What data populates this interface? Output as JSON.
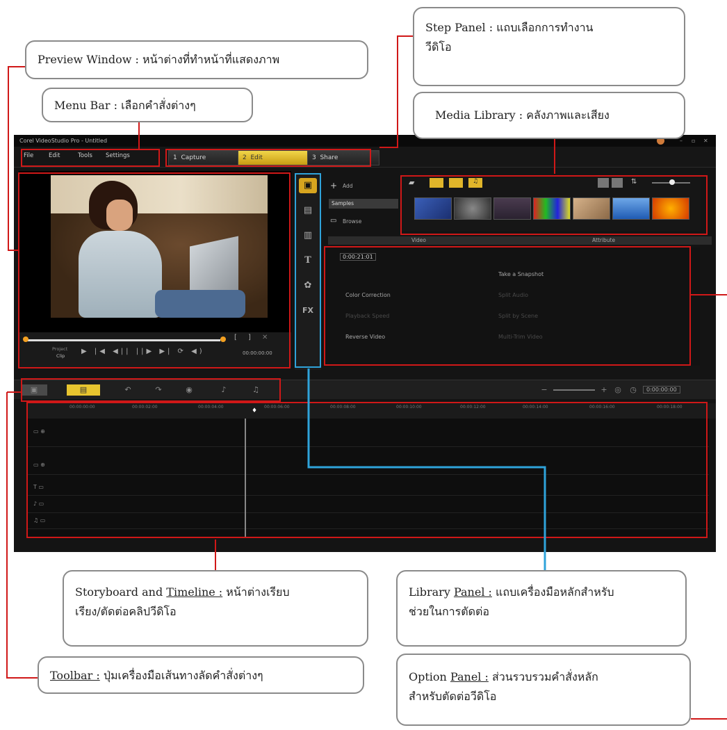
{
  "callouts": {
    "preview_window": {
      "label": "Preview Window",
      "sep": " : ",
      "desc": "หน้าต่างที่ทำหน้าที่แสดงภาพ"
    },
    "menu_bar": {
      "label": "Menu Bar",
      "sep": " : ",
      "desc": "เลือกคำสั่งต่างๆ"
    },
    "step_panel": {
      "label": "Step Panel :",
      "desc_line1": "แถบเลือกการทำงาน",
      "desc_line2": "วีดิโอ"
    },
    "media_library": {
      "label": "Media Library",
      "sep": " : ",
      "desc": "คลังภาพและเสียง"
    },
    "storyboard": {
      "label": "Storyboard and",
      "label_u": "Timeline :",
      "desc_line1": "หน้าต่างเรียบ",
      "desc_line2": "เรียง/ตัดต่อคลิปวีดิโอ"
    },
    "library_panel": {
      "label": "Library",
      "label_u": "Panel :",
      "desc_line1": "แถบเครื่องมือหลักสำหรับ",
      "desc_line2": "ช่วยในการตัดต่อ"
    },
    "toolbar": {
      "label_u": "Toolbar :",
      "desc": "ปุ่มเครื่องมือเส้นทางลัดคำสั่งต่างๆ"
    },
    "option_panel": {
      "label": "Option",
      "label_u": "Panel :",
      "desc_line1": "ส่วนรวบรวมคำสั่งหลัก",
      "desc_line2": "สำหรับตัดต่อวีดิโอ"
    }
  },
  "app": {
    "title": "Corel VideoStudio Pro - Untitled",
    "menu": [
      "File",
      "Edit",
      "Tools",
      "Settings"
    ],
    "steps": [
      {
        "num": "1",
        "label": "Capture"
      },
      {
        "num": "2",
        "label": "Edit"
      },
      {
        "num": "3",
        "label": "Share"
      }
    ],
    "library": {
      "add": "Add",
      "samples": "Samples",
      "browse": "Browse"
    },
    "tabs": {
      "video": "Video",
      "attribute": "Attribute"
    },
    "preview": {
      "project_label": "Project",
      "clip_label": "Clip",
      "timecode": "00:00:00:00"
    },
    "options": {
      "duration": "0:00:21:01",
      "color_correction": "Color Correction",
      "playback_speed": "Playback Speed",
      "reverse_video": "Reverse Video",
      "take_snapshot": "Take a Snapshot",
      "split_audio": "Split Audio",
      "split_by_scene": "Split by Scene",
      "multi_trim": "Multi-Trim Video"
    },
    "timeline": {
      "timecode": "0:00:00:00",
      "ruler": [
        "00:00:00:00",
        "00:00:02:00",
        "00:00:04:00",
        "00:00:06:00",
        "00:00:08:00",
        "00:00:10:00",
        "00:00:12:00",
        "00:00:14:00",
        "00:00:16:00",
        "00:00:18:00"
      ]
    }
  },
  "colors": {
    "callout_border": "#8a8a8a",
    "red": "#d01818",
    "blue": "#2fa3da",
    "edit_tab": "#e8c52f"
  }
}
